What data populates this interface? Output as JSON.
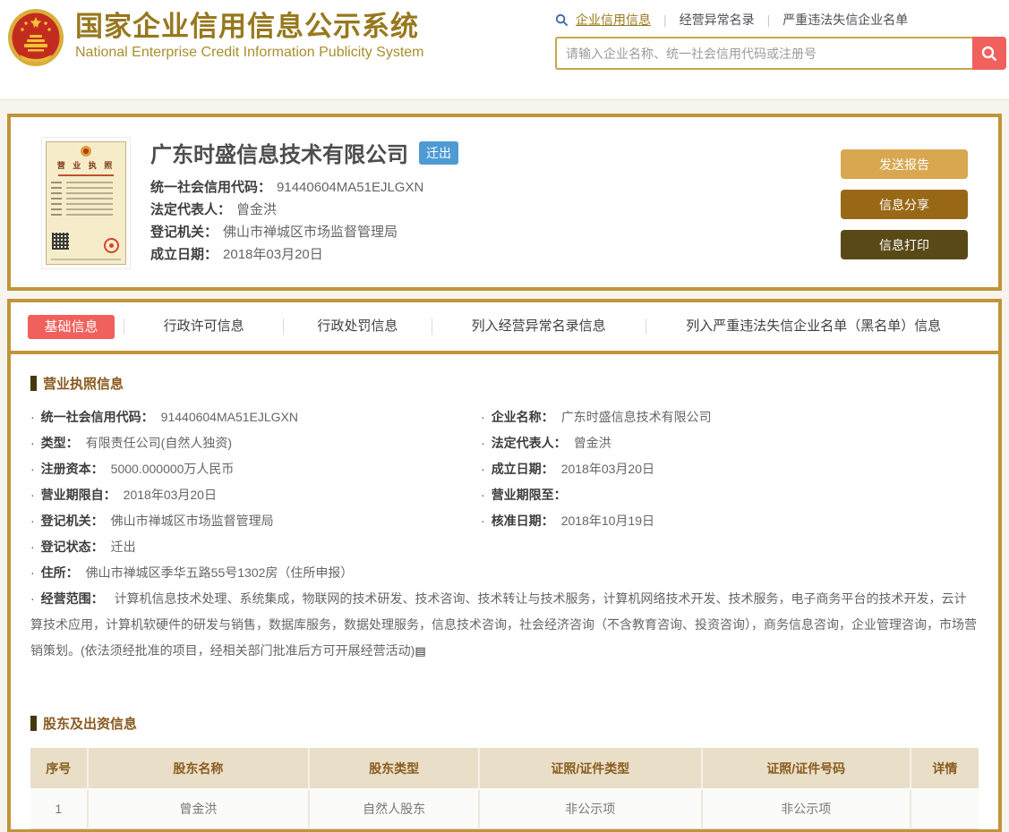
{
  "ui": {
    "bullet": "·",
    "nav_divider": "|",
    "scope_icon": "▤"
  },
  "colors": {
    "brand_gold": "#c0953a",
    "title_gold": "#97781e",
    "accent_red": "#f0605c",
    "badge_blue": "#4e9bd4",
    "btn_send": "#d8a74f",
    "btn_share": "#996817",
    "btn_print": "#594917",
    "table_header_bg": "#e9dec8",
    "section_brown": "#8a5a20"
  },
  "header": {
    "title": "国家企业信用信息公示系统",
    "subtitle": "National Enterprise Credit Information Publicity System",
    "nav": [
      {
        "label": "企业信用信息"
      },
      {
        "label": "经营异常名录"
      },
      {
        "label": "严重违法失信企业名单"
      }
    ],
    "search_placeholder": "请输入企业名称、统一社会信用代码或注册号"
  },
  "company": {
    "name": "广东时盛信息技术有限公司",
    "status_badge": "迁出",
    "license_title": "营 业 执 照",
    "summary": [
      {
        "label": "统一社会信用代码：",
        "value": "91440604MA51EJLGXN"
      },
      {
        "label": "法定代表人：",
        "value": "曾金洪"
      },
      {
        "label": "登记机关：",
        "value": "佛山市禅城区市场监督管理局"
      },
      {
        "label": "成立日期：",
        "value": "2018年03月20日"
      }
    ],
    "actions": [
      {
        "label": "发送报告"
      },
      {
        "label": "信息分享"
      },
      {
        "label": "信息打印"
      }
    ]
  },
  "tabs": [
    "基础信息",
    "行政许可信息",
    "行政处罚信息",
    "列入经营异常名录信息",
    "列入严重违法失信企业名单（黑名单）信息"
  ],
  "license_section": {
    "title": "营业执照信息",
    "left_fields": [
      {
        "label": "统一社会信用代码：",
        "value": "91440604MA51EJLGXN"
      },
      {
        "label": "类型：",
        "value": "有限责任公司(自然人独资)"
      },
      {
        "label": "注册资本：",
        "value": "5000.000000万人民币"
      },
      {
        "label": "营业期限自：",
        "value": "2018年03月20日"
      },
      {
        "label": "登记机关：",
        "value": "佛山市禅城区市场监督管理局"
      },
      {
        "label": "登记状态：",
        "value": "迁出"
      },
      {
        "label": "住所：",
        "value": "佛山市禅城区季华五路55号1302房（住所申报）"
      }
    ],
    "right_fields": [
      {
        "label": "企业名称：",
        "value": "广东时盛信息技术有限公司"
      },
      {
        "label": "法定代表人：",
        "value": "曾金洪"
      },
      {
        "label": "成立日期：",
        "value": "2018年03月20日"
      },
      {
        "label": "营业期限至：",
        "value": ""
      },
      {
        "label": "核准日期：",
        "value": "2018年10月19日"
      }
    ],
    "scope_label": "经营范围：",
    "scope_value": "计算机信息技术处理、系统集成，物联网的技术研发、技术咨询、技术转让与技术服务，计算机网络技术开发、技术服务，电子商务平台的技术开发，云计算技术应用，计算机软硬件的研发与销售，数据库服务，数据处理服务，信息技术咨询，社会经济咨询（不含教育咨询、投资咨询），商务信息咨询，企业管理咨询，市场营销策划。(依法须经批准的项目，经相关部门批准后方可开展经营活动)"
  },
  "shareholder_section": {
    "title": "股东及出资信息",
    "columns": [
      "序号",
      "股东名称",
      "股东类型",
      "证照/证件类型",
      "证照/证件号码",
      "详情"
    ],
    "rows": [
      [
        "1",
        "曾金洪",
        "自然人股东",
        "非公示项",
        "非公示项",
        ""
      ]
    ]
  }
}
